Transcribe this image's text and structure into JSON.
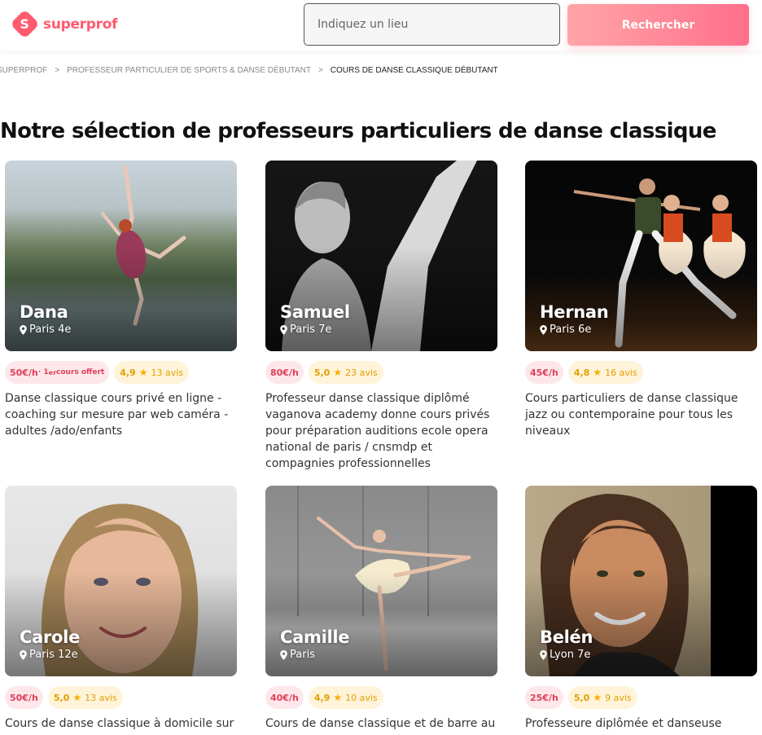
{
  "header": {
    "logo_letter": "S",
    "logo_text": "superprof",
    "search_placeholder": "Indiquez un lieu",
    "search_button": "Rechercher"
  },
  "breadcrumb": {
    "items": [
      "SUPERPROF",
      "PROFESSEUR PARTICULIER DE SPORTS & DANSE DÉBUTANT",
      "COURS DE DANSE CLASSIQUE DÉBUTANT"
    ],
    "separator": ">"
  },
  "page_title": "Notre sélection de professeurs particuliers de danse classique",
  "tutors": [
    {
      "name": "Dana",
      "location": "Paris 4e",
      "price": "50€/h",
      "offer_prefix": " · 1",
      "offer_sup": "er",
      "offer_text": " cours offert",
      "rating": "4,9",
      "reviews": "13 avis",
      "description": "Danse classique cours privé en ligne - coaching sur mesure par web caméra - adultes /ado/enfants"
    },
    {
      "name": "Samuel",
      "location": "Paris 7e",
      "price": "80€/h",
      "rating": "5,0",
      "reviews": "23 avis",
      "description": "Professeur danse classique diplômé vaganova academy donne cours privés pour préparation auditions ecole opera national de paris / cnsmdp et compagnies professionnelles"
    },
    {
      "name": "Hernan",
      "location": "Paris 6e",
      "price": "45€/h",
      "rating": "4,8",
      "reviews": "16 avis",
      "description": "Cours particuliers de danse classique jazz ou contemporaine pour tous les niveaux"
    },
    {
      "name": "Carole",
      "location": "Paris 12e",
      "price": "50€/h",
      "rating": "5,0",
      "reviews": "13 avis",
      "description": "Cours de danse classique à domicile sur"
    },
    {
      "name": "Camille",
      "location": "Paris",
      "price": "40€/h",
      "rating": "4,9",
      "reviews": "10 avis",
      "description": "Cours de danse classique et de barre au"
    },
    {
      "name": "Belén",
      "location": "Lyon 7e",
      "price": "25€/h",
      "rating": "5,0",
      "reviews": "9 avis",
      "description": "Professeure diplômée et danseuse"
    }
  ],
  "colors": {
    "brand": "#ff5a6e",
    "price_bg": "#fde7ea",
    "rating_bg": "#fff3d9",
    "star": "#f5b000"
  },
  "icons": {
    "location": "pin-icon",
    "rating": "star-icon"
  }
}
